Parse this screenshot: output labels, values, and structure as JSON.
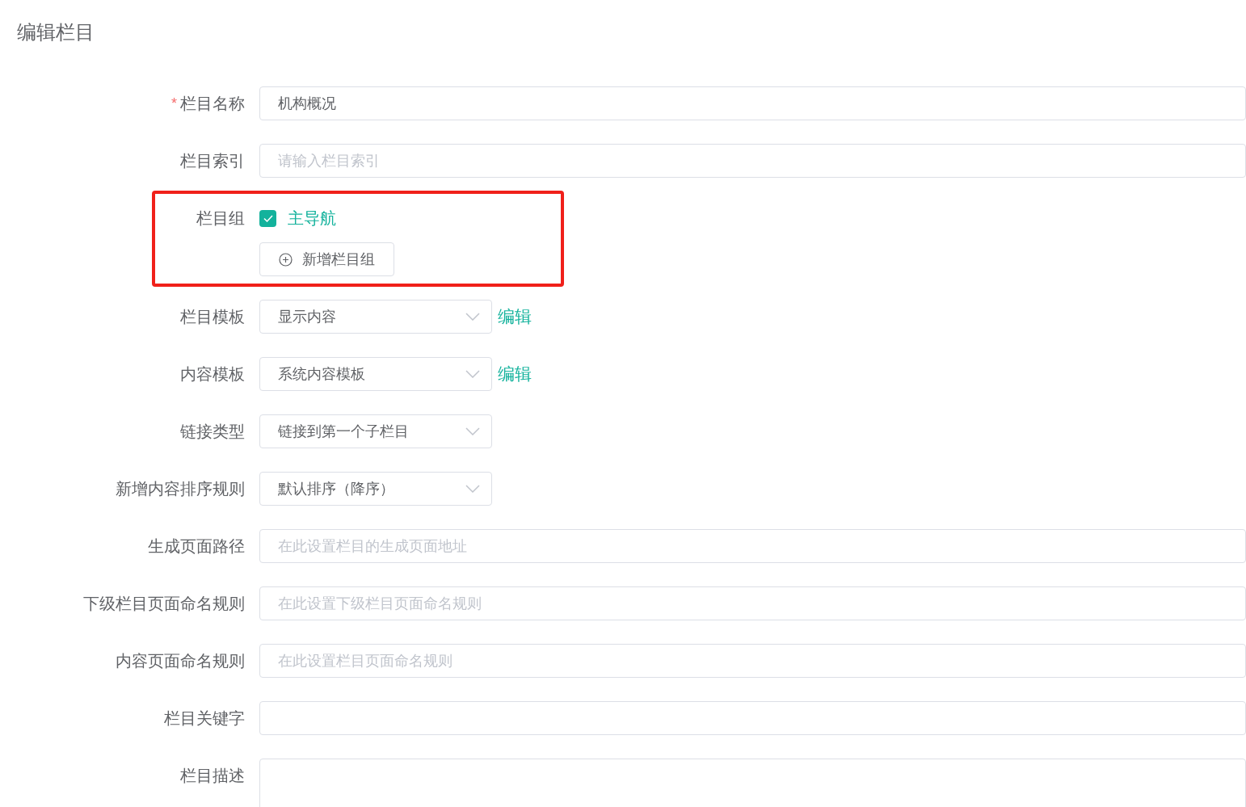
{
  "page": {
    "title": "编辑栏目"
  },
  "fields": [
    {
      "kind": "text",
      "label": "栏目名称",
      "required_mark": "*",
      "value": "机构概况"
    },
    {
      "kind": "text",
      "label": "栏目索引",
      "placeholder": "请输入栏目索引"
    },
    {
      "kind": "group",
      "label": "栏目组",
      "highlighted": true,
      "options": [
        {
          "label": "主导航",
          "checked": true
        }
      ],
      "add_button": "新增栏目组"
    },
    {
      "kind": "select",
      "label": "栏目模板",
      "value": "显示内容",
      "link": "编辑"
    },
    {
      "kind": "select",
      "label": "内容模板",
      "value": "系统内容模板",
      "link": "编辑"
    },
    {
      "kind": "select",
      "label": "链接类型",
      "value": "链接到第一个子栏目"
    },
    {
      "kind": "select",
      "label": "新增内容排序规则",
      "value": "默认排序（降序）"
    },
    {
      "kind": "text",
      "label": "生成页面路径",
      "placeholder": "在此设置栏目的生成页面地址"
    },
    {
      "kind": "text",
      "label": "下级栏目页面命名规则",
      "placeholder": "在此设置下级栏目页面命名规则"
    },
    {
      "kind": "text",
      "label": "内容页面命名规则",
      "placeholder": "在此设置栏目页面命名规则"
    },
    {
      "kind": "text",
      "label": "栏目关键字"
    },
    {
      "kind": "textarea",
      "label": "栏目描述"
    }
  ]
}
